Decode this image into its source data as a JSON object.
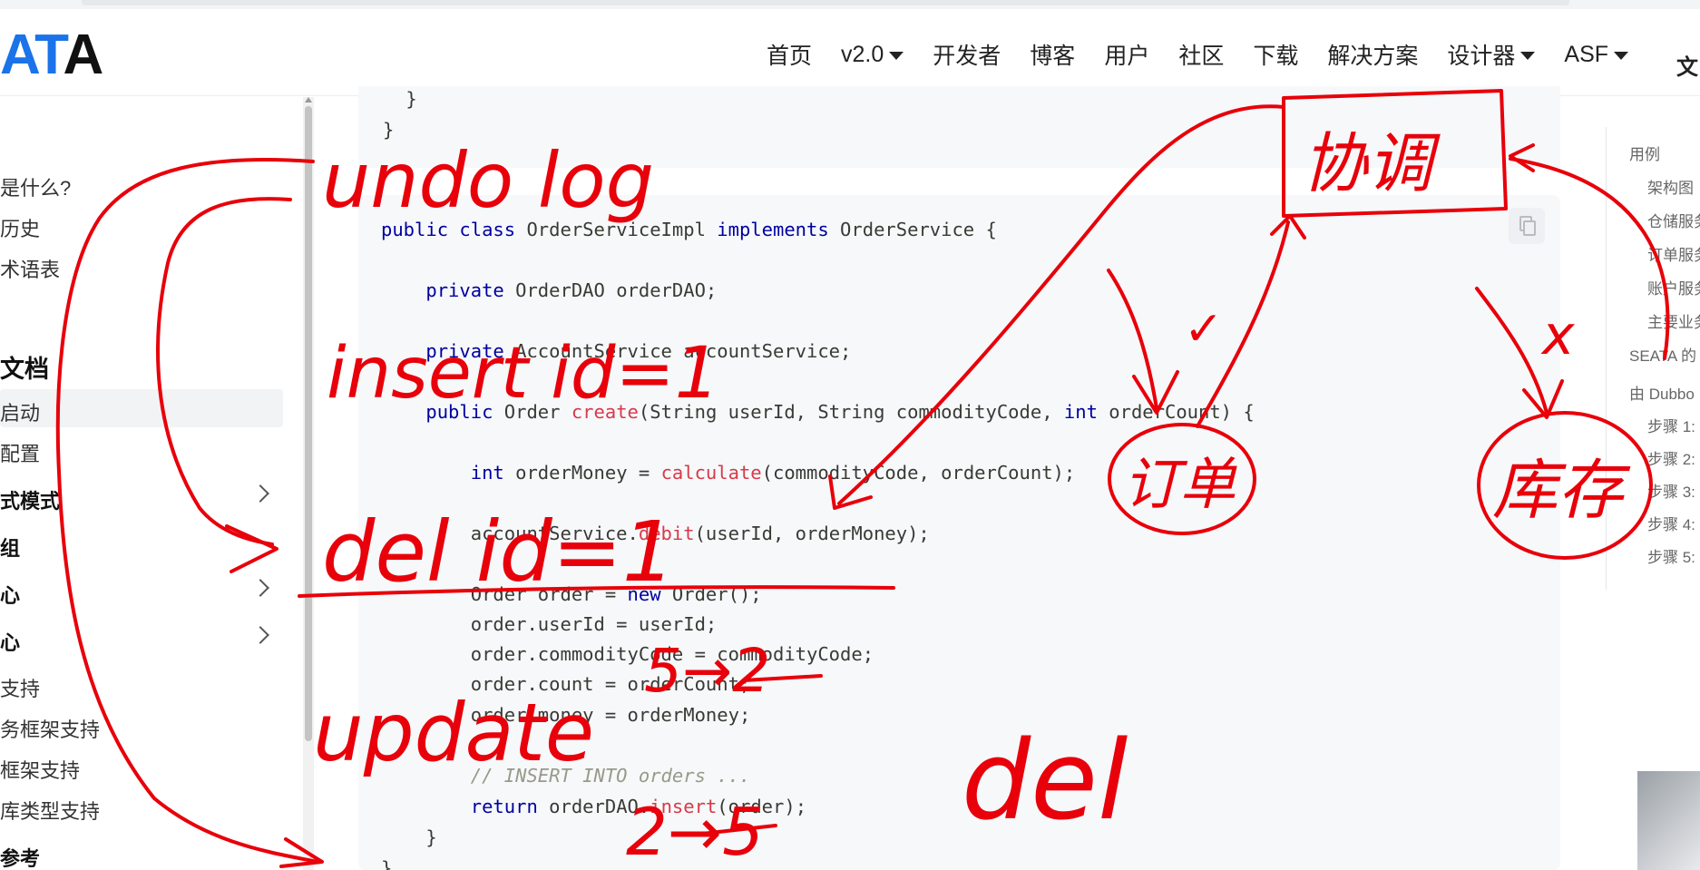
{
  "nav": {
    "logo_dark_left": "",
    "logo_accent": "AT",
    "logo_dark_right": "A",
    "items": [
      "首页",
      "v2.0",
      "开发者",
      "博客",
      "用户",
      "社区",
      "下载",
      "解决方案",
      "设计器",
      "ASF"
    ],
    "lang_glyph": "文"
  },
  "sidebar": {
    "items": [
      "是什么?",
      "历史",
      "术语表",
      "文档",
      "启动",
      "配置",
      "式模式",
      "组",
      "心",
      "心",
      "支持",
      "务框架支持",
      "框架支持",
      "库类型支持",
      "参考"
    ]
  },
  "code_top": {
    "line1": "    }",
    "line2": "}"
  },
  "code": {
    "l1_a": "public class ",
    "l1_b": "OrderServiceImpl ",
    "l1_c": "implements ",
    "l1_d": "OrderService {",
    "l2_a": "    private ",
    "l2_b": "OrderDAO orderDAO;",
    "l3_a": "    private ",
    "l3_b": "AccountService accountService;",
    "l4_a": "    public ",
    "l4_b": "Order ",
    "l4_c": "create",
    "l4_d": "(String userId, String commodityCode, ",
    "l4_e": "int ",
    "l4_f": "orderCount) {",
    "l5_a": "        int ",
    "l5_b": "orderMoney = ",
    "l5_c": "calculate",
    "l5_d": "(commodityCode, orderCount);",
    "l6_a": "        accountService.",
    "l6_b": "debit",
    "l6_c": "(userId, orderMoney);",
    "l7_a": "        Order order = ",
    "l7_b": "new ",
    "l7_c": "Order();",
    "l8": "        order.userId = userId;",
    "l9": "        order.commodityCode = commodityCode;",
    "l10": "        order.count = orderCount;",
    "l11": "        order.money = orderMoney;",
    "l12": "        // INSERT INTO orders ...",
    "l13_a": "        return ",
    "l13_b": "orderDAO.",
    "l13_c": "insert",
    "l13_d": "(order);",
    "l14": "    }",
    "l15": "}"
  },
  "toc": {
    "items": [
      "用例",
      "架构图",
      "仓储服务",
      "订单服务",
      "账户服务",
      "主要业务",
      "SEATA 的",
      "由 Dubbo",
      "步骤 1:",
      "步骤 2:",
      "步骤 3:",
      "步骤 4:",
      "步骤 5:"
    ]
  },
  "annotations": {
    "undo_log": "undo log",
    "insert": "insert id=1",
    "del_id": "del id=1",
    "update": "update",
    "five_two": "5→2",
    "two_five": "2→5",
    "del": "del",
    "coord": "协调",
    "order": "订单",
    "stock": "库存",
    "check": "✓",
    "cross": "x"
  },
  "colors": {
    "ink": "#e8000a",
    "keyword": "#00009f",
    "function": "#d73a49",
    "comment": "#999988",
    "accent": "#1a73e8"
  }
}
